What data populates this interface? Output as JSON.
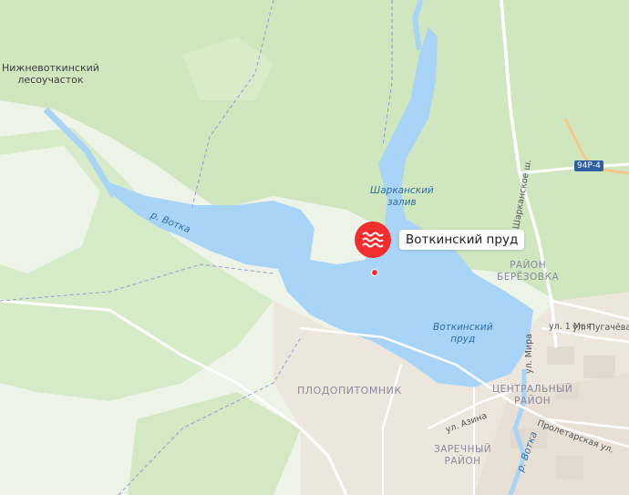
{
  "map": {
    "selected_place": {
      "name": "Воткинский пруд",
      "icon": "water-waves-icon",
      "marker_color": "#f22e2e"
    },
    "places": {
      "forestry": "Нижневоткинский\nлесоучасток",
      "nursery": "ПЛОДОПИТОМНИК",
      "berezovka": "РАЙОН\nБЕРЁЗОВКА",
      "central": "ЦЕНТРАЛЬНЫЙ\nРАЙОН",
      "zarechny": "ЗАРЕЧНЫЙ\nРАЙОН"
    },
    "water": {
      "river_votka_west": "р. Вотка",
      "river_votka_east": "р. Вотка",
      "sharkan_bay": "Шарканский\nзалив",
      "pond": "Воткинский\nпруд"
    },
    "streets": {
      "sharkanskoe": "Шарканское ш.",
      "may1": "ул. 1 Мая",
      "mira": "ул. Мира",
      "pugacheva": "ул. Пугачёва",
      "azina": "ул. Азина",
      "proletarskaya": "Пролетарская ул."
    },
    "highway_badge": "94Р-4",
    "colors": {
      "water": "#a8d5f7",
      "forest": "#cfe6bf",
      "field": "#eef3e8",
      "urban": "#ede6dc",
      "road": "#ffffff",
      "highway": "#2f5fa0"
    }
  }
}
